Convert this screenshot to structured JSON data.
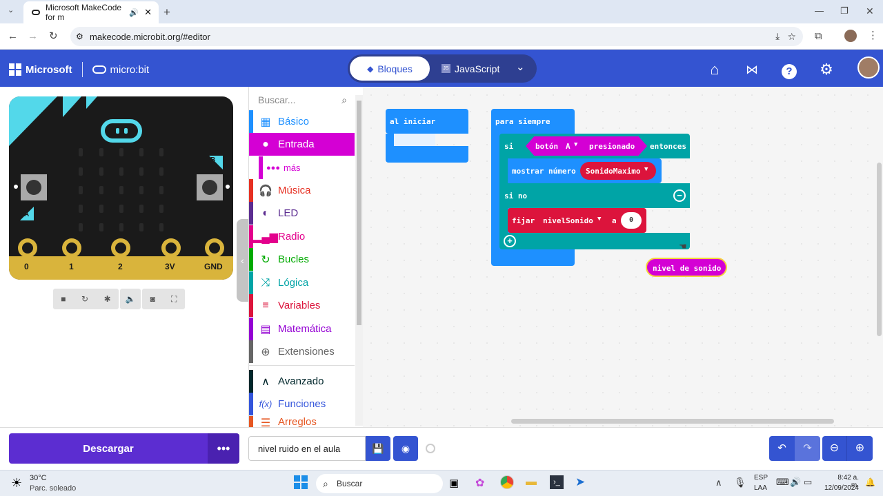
{
  "browser": {
    "tab_title": "Microsoft MakeCode for m",
    "url": "makecode.microbit.org/#editor"
  },
  "header": {
    "brand": "Microsoft",
    "product": "micro:bit",
    "tab_blocks": "Bloques",
    "tab_js": "JavaScript"
  },
  "simulator": {
    "pins": [
      "0",
      "1",
      "2",
      "3V",
      "GND"
    ],
    "btn_a": "A",
    "btn_b": "B"
  },
  "toolbox": {
    "search_placeholder": "Buscar...",
    "items": [
      {
        "label": "Básico",
        "color": "#1e90ff",
        "icon": "grid-icon"
      },
      {
        "label": "Entrada",
        "color": "#d400d4",
        "icon": "circle-icon"
      },
      {
        "label": "más",
        "color": "#d400d4",
        "icon": "dots-icon"
      },
      {
        "label": "Música",
        "color": "#e63022",
        "icon": "headphones-icon"
      },
      {
        "label": "LED",
        "color": "#5c2d91",
        "icon": "toggle-icon"
      },
      {
        "label": "Radio",
        "color": "#e3008c",
        "icon": "signal-icon"
      },
      {
        "label": "Bucles",
        "color": "#00aa00",
        "icon": "loop-icon"
      },
      {
        "label": "Lógica",
        "color": "#00a4a6",
        "icon": "shuffle-icon"
      },
      {
        "label": "Variables",
        "color": "#dc143c",
        "icon": "lines-icon"
      },
      {
        "label": "Matemática",
        "color": "#9400d3",
        "icon": "calculator-icon"
      },
      {
        "label": "Extensiones",
        "color": "#666666",
        "icon": "plus-icon"
      },
      {
        "label": "Avanzado",
        "color": "#00272b",
        "icon": "chevron-up-icon"
      },
      {
        "label": "Funciones",
        "color": "#3455db",
        "icon": "function-icon"
      },
      {
        "label": "Arreglos",
        "color": "#e65722",
        "icon": "list-icon"
      }
    ]
  },
  "blocks": {
    "on_start": "al iniciar",
    "forever": "para siempre",
    "if_kw": "si",
    "button_text": "botón",
    "button_value": "A",
    "pressed": "presionado",
    "then": "entonces",
    "show_number": "mostrar número",
    "var_max": "SonidoMaximo",
    "else_kw": "si no",
    "set_kw": "fijar",
    "var_level": "nivelSonido",
    "to_kw": "a",
    "num_value": "0",
    "sound_level": "nivel de sonido"
  },
  "footer": {
    "download": "Descargar",
    "more": "•••",
    "project_name": "nivel ruido en el aula"
  },
  "taskbar": {
    "weather_temp": "30°C",
    "weather_desc": "Parc. soleado",
    "search": "Buscar",
    "lang1": "ESP",
    "lang2": "LAA",
    "time": "8:42 a. m.",
    "date": "12/09/2024"
  }
}
